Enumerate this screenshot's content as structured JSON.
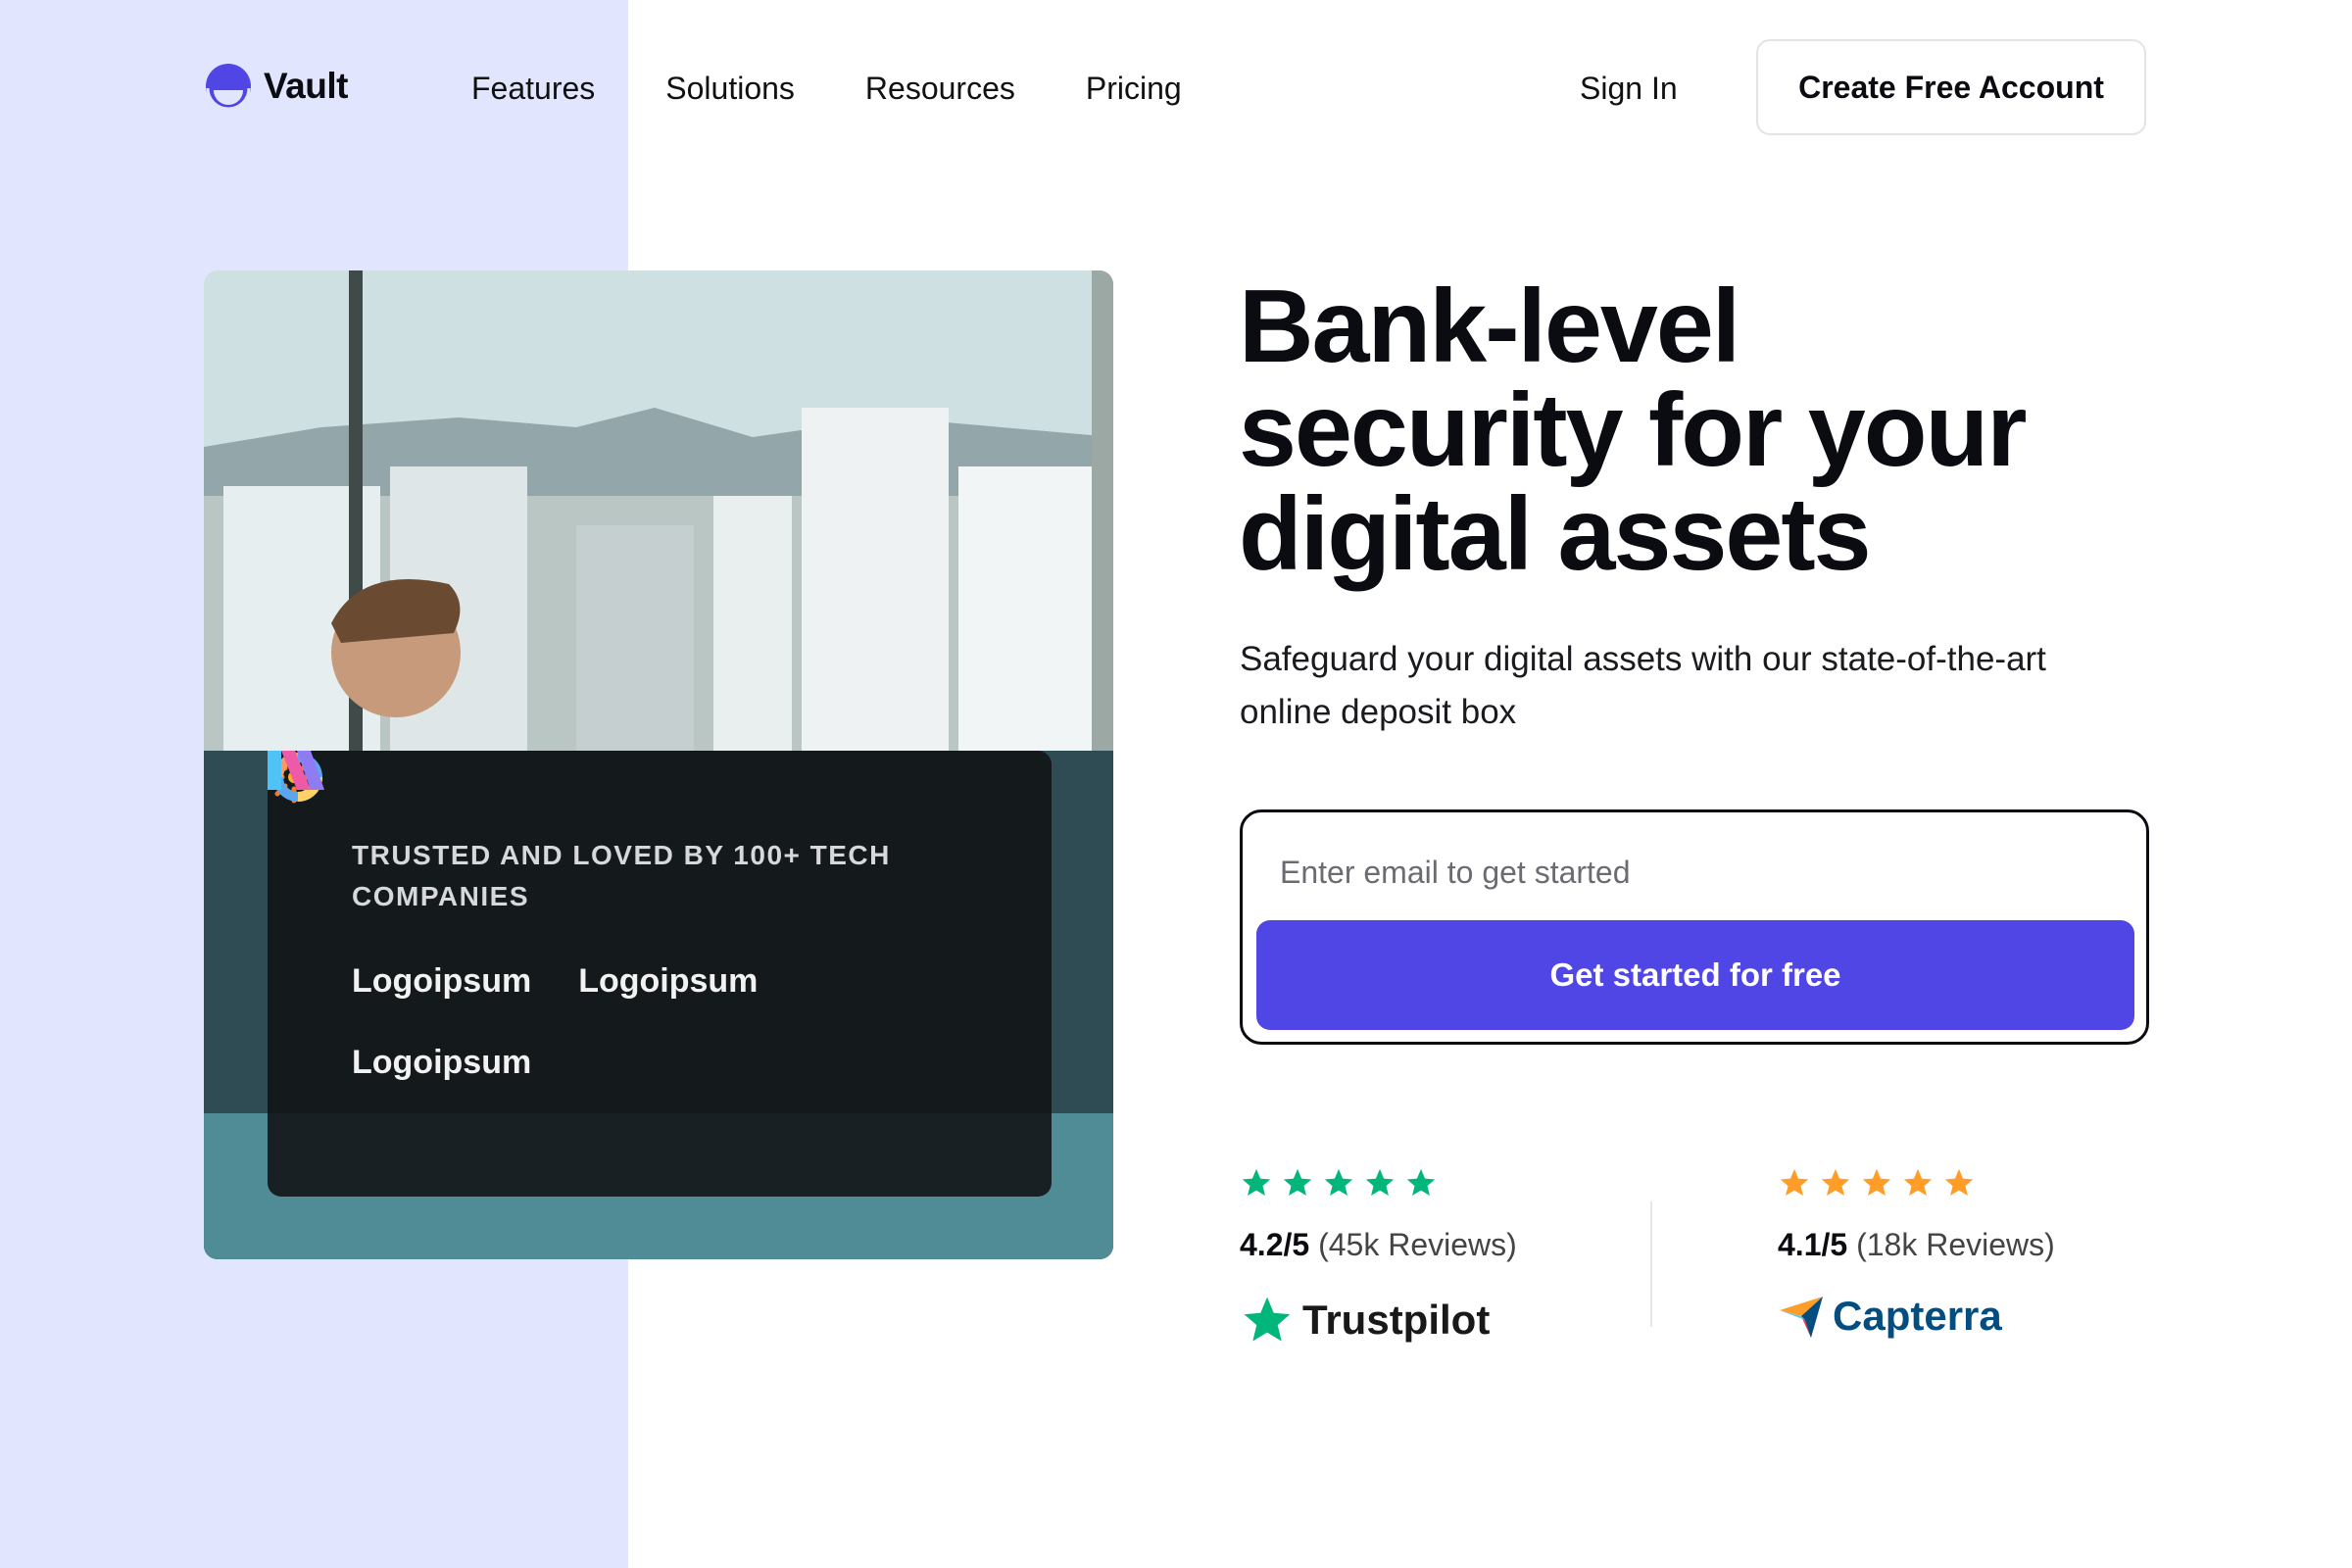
{
  "brand": {
    "name": "Vault",
    "accent": "#5046e5",
    "band": "#e1e6fe"
  },
  "nav": {
    "items": [
      {
        "label": "Features"
      },
      {
        "label": "Solutions"
      },
      {
        "label": "Resources"
      },
      {
        "label": "Pricing"
      }
    ]
  },
  "header": {
    "sign_in": "Sign In",
    "cta": "Create Free Account"
  },
  "hero": {
    "trust_title": "TRUSTED AND LOVED BY 100+ TECH COMPANIES",
    "logos": [
      {
        "name": "Logoipsum",
        "icon": "sunburst-icon"
      },
      {
        "name": "Logoipsum",
        "icon": "ring-icon"
      },
      {
        "name": "Logoipsum",
        "icon": "stripes-icon"
      }
    ]
  },
  "main": {
    "headline": "Bank-level security for your digital assets",
    "subhead": "Safeguard your digital assets with our state-of-the-art online deposit box",
    "email_placeholder": "Enter email to get started",
    "submit_label": "Get started for free"
  },
  "ratings": [
    {
      "score": "4.2/5",
      "reviews": "(45k Reviews)",
      "stars": 5,
      "star_color": "#00b67a",
      "platform": "Trustpilot"
    },
    {
      "score": "4.1/5",
      "reviews": "(18k Reviews)",
      "stars": 5,
      "star_color": "#ff9d28",
      "platform": "Capterra"
    }
  ]
}
